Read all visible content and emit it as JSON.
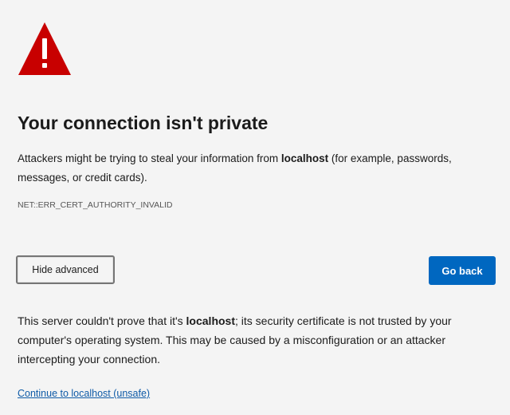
{
  "icon": "warning-triangle-icon",
  "colors": {
    "warning": "#c80000",
    "primary_button": "#0067c0",
    "link": "#0f5ba7",
    "background": "#f4f4f4"
  },
  "heading": "Your connection isn't private",
  "explanation": {
    "before": "Attackers might be trying to steal your information from ",
    "host": "localhost",
    "after": " (for example, passwords, messages, or credit cards)."
  },
  "error_code": "NET::ERR_CERT_AUTHORITY_INVALID",
  "buttons": {
    "advanced_label": "Hide advanced",
    "back_label": "Go back"
  },
  "details": {
    "before": "This server couldn't prove that it's ",
    "host": "localhost",
    "after": "; its security certificate is not trusted by your computer's operating system. This may be caused by a misconfiguration or an attacker intercepting your connection."
  },
  "proceed_link": "Continue to localhost (unsafe)"
}
